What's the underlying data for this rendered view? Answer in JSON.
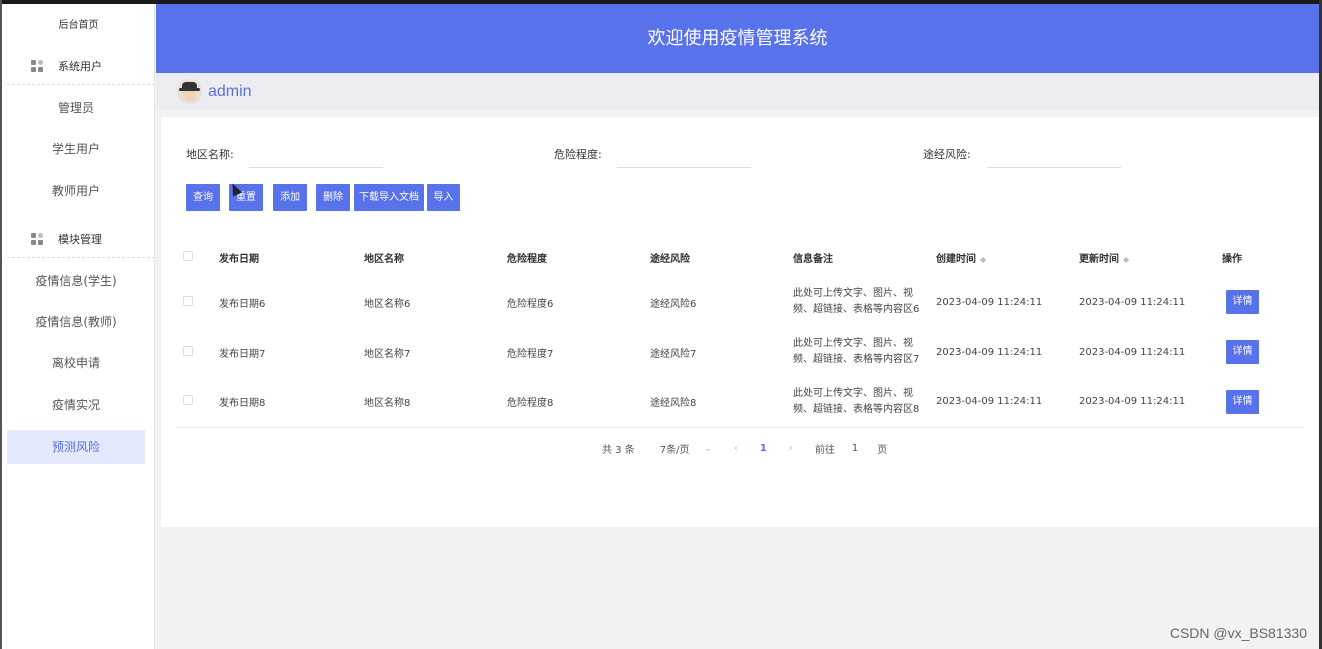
{
  "app": {
    "title": "欢迎使用疫情管理系统",
    "username": "admin"
  },
  "sidebar": {
    "home": "后台首页",
    "group_users": "系统用户",
    "group_modules": "模块管理",
    "items": [
      {
        "label": "管理员"
      },
      {
        "label": "学生用户"
      },
      {
        "label": "教师用户"
      },
      {
        "label": "疫情信息(学生)"
      },
      {
        "label": "疫情信息(教师)"
      },
      {
        "label": "离校申请"
      },
      {
        "label": "疫情实况"
      },
      {
        "label": "预测风险",
        "active": true
      }
    ]
  },
  "search": {
    "region_label": "地区名称:",
    "region_value": "",
    "danger_label": "危险程度:",
    "danger_value": "",
    "route_label": "途经风险:",
    "route_value": ""
  },
  "toolbar": {
    "query": "查询",
    "reset": "重置",
    "add": "添加",
    "delete": "删除",
    "download_template": "下载导入文档",
    "import": "导入"
  },
  "table": {
    "headers": {
      "date": "发布日期",
      "region": "地区名称",
      "danger": "危险程度",
      "route": "途经风险",
      "remark": "信息备注",
      "created": "创建时间",
      "updated": "更新时间",
      "action": "操作"
    },
    "rows": [
      {
        "date": "发布日期6",
        "region": "地区名称6",
        "danger": "危险程度6",
        "route": "途经风险6",
        "remark_line1": "此处可上传文字、图片、视",
        "remark_line2": "频、超链接、表格等内容区6",
        "created": "2023-04-09 11:24:11",
        "updated": "2023-04-09 11:24:11",
        "action": "详情"
      },
      {
        "date": "发布日期7",
        "region": "地区名称7",
        "danger": "危险程度7",
        "route": "途经风险7",
        "remark_line1": "此处可上传文字、图片、视",
        "remark_line2": "频、超链接、表格等内容区7",
        "created": "2023-04-09 11:24:11",
        "updated": "2023-04-09 11:24:11",
        "action": "详情"
      },
      {
        "date": "发布日期8",
        "region": "地区名称8",
        "danger": "危险程度8",
        "route": "途经风险8",
        "remark_line1": "此处可上传文字、图片、视",
        "remark_line2": "频、超链接、表格等内容区8",
        "created": "2023-04-09 11:24:11",
        "updated": "2023-04-09 11:24:11",
        "action": "详情"
      }
    ]
  },
  "pagination": {
    "total": "共 3 条",
    "page_size": "7条/页",
    "current_page": "1",
    "goto_label": "前往",
    "goto_value": "1",
    "page_suffix": "页"
  },
  "watermark": "CSDN @vx_BS81330",
  "colors": {
    "accent": "#5872eb",
    "active_bg": "#e5e9fd"
  }
}
